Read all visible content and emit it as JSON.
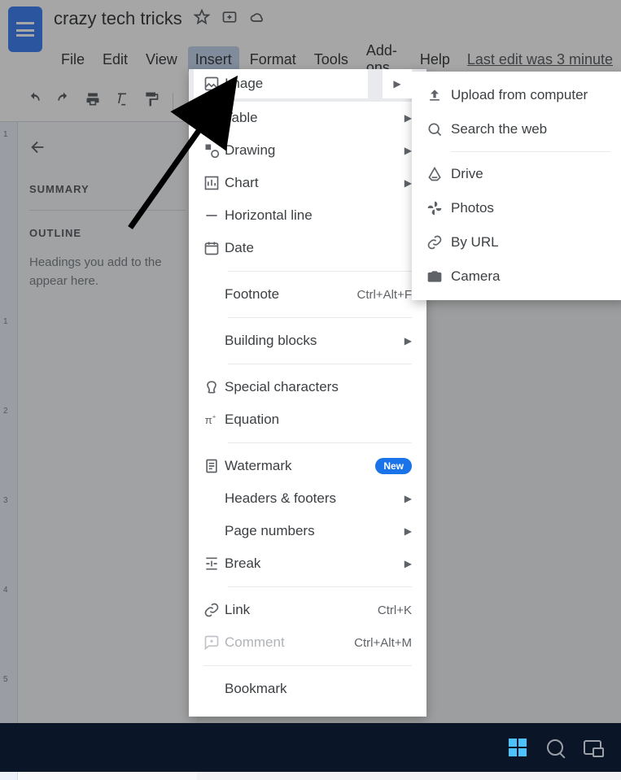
{
  "doc": {
    "title": "crazy tech tricks",
    "last_edit": "Last edit was 3 minute"
  },
  "menubar": [
    "File",
    "Edit",
    "View",
    "Insert",
    "Format",
    "Tools",
    "Add-ons",
    "Help"
  ],
  "menubar_active": "Insert",
  "sidebar": {
    "summary_label": "SUMMARY",
    "outline_label": "OUTLINE",
    "outline_hint": "Headings you add to the",
    "outline_hint2": "appear here."
  },
  "insert_menu": [
    {
      "icon": "image",
      "label": "Image",
      "arrow": true,
      "highlight": true
    },
    {
      "icon": "table",
      "label": "Table",
      "arrow": true
    },
    {
      "icon": "drawing",
      "label": "Drawing",
      "arrow": true
    },
    {
      "icon": "chart",
      "label": "Chart",
      "arrow": true
    },
    {
      "icon": "hr",
      "label": "Horizontal line"
    },
    {
      "icon": "date",
      "label": "Date"
    },
    {
      "sep": true
    },
    {
      "icon": "",
      "label": "Footnote",
      "shortcut": "Ctrl+Alt+F"
    },
    {
      "sep": true
    },
    {
      "icon": "",
      "label": "Building blocks",
      "arrow": true
    },
    {
      "sep": true
    },
    {
      "icon": "special",
      "label": "Special characters"
    },
    {
      "icon": "equation",
      "label": "Equation"
    },
    {
      "sep": true
    },
    {
      "icon": "watermark",
      "label": "Watermark",
      "badge": "New"
    },
    {
      "icon": "",
      "label": "Headers & footers",
      "arrow": true
    },
    {
      "icon": "",
      "label": "Page numbers",
      "arrow": true
    },
    {
      "icon": "break",
      "label": "Break",
      "arrow": true
    },
    {
      "sep": true
    },
    {
      "icon": "link",
      "label": "Link",
      "shortcut": "Ctrl+K"
    },
    {
      "icon": "comment",
      "label": "Comment",
      "shortcut": "Ctrl+Alt+M",
      "disabled": true
    },
    {
      "sep": true,
      "full": true
    },
    {
      "icon": "",
      "label": "Bookmark"
    }
  ],
  "image_submenu": [
    {
      "icon": "upload",
      "label": "Upload from computer"
    },
    {
      "icon": "search",
      "label": "Search the web"
    },
    {
      "sep": true
    },
    {
      "icon": "drive",
      "label": "Drive"
    },
    {
      "icon": "photos",
      "label": "Photos"
    },
    {
      "icon": "url",
      "label": "By URL"
    },
    {
      "icon": "camera",
      "label": "Camera"
    }
  ],
  "ruler_ticks": [
    "1",
    "1",
    "2",
    "3",
    "4",
    "5"
  ]
}
